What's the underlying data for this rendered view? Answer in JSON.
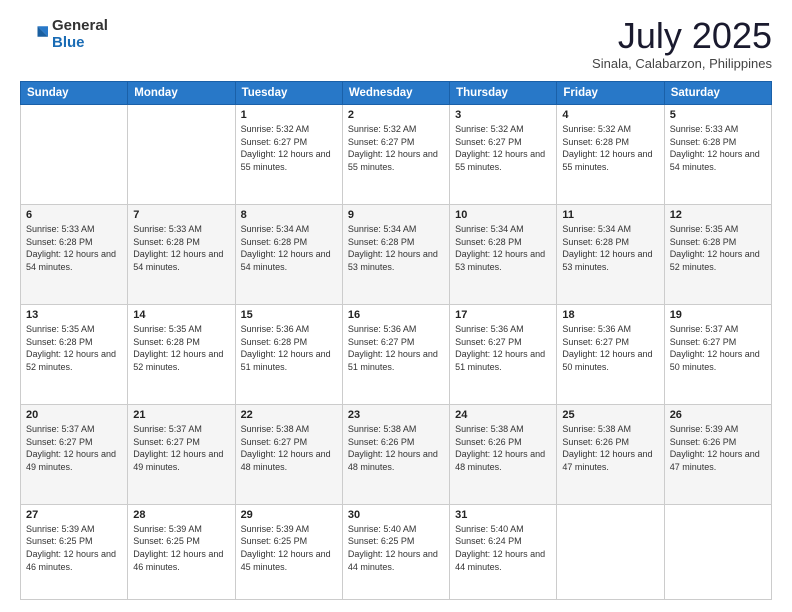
{
  "header": {
    "logo_general": "General",
    "logo_blue": "Blue",
    "month_year": "July 2025",
    "location": "Sinala, Calabarzon, Philippines"
  },
  "weekdays": [
    "Sunday",
    "Monday",
    "Tuesday",
    "Wednesday",
    "Thursday",
    "Friday",
    "Saturday"
  ],
  "weeks": [
    [
      {
        "day": "",
        "sunrise": "",
        "sunset": "",
        "daylight": ""
      },
      {
        "day": "",
        "sunrise": "",
        "sunset": "",
        "daylight": ""
      },
      {
        "day": "1",
        "sunrise": "Sunrise: 5:32 AM",
        "sunset": "Sunset: 6:27 PM",
        "daylight": "Daylight: 12 hours and 55 minutes."
      },
      {
        "day": "2",
        "sunrise": "Sunrise: 5:32 AM",
        "sunset": "Sunset: 6:27 PM",
        "daylight": "Daylight: 12 hours and 55 minutes."
      },
      {
        "day": "3",
        "sunrise": "Sunrise: 5:32 AM",
        "sunset": "Sunset: 6:27 PM",
        "daylight": "Daylight: 12 hours and 55 minutes."
      },
      {
        "day": "4",
        "sunrise": "Sunrise: 5:32 AM",
        "sunset": "Sunset: 6:28 PM",
        "daylight": "Daylight: 12 hours and 55 minutes."
      },
      {
        "day": "5",
        "sunrise": "Sunrise: 5:33 AM",
        "sunset": "Sunset: 6:28 PM",
        "daylight": "Daylight: 12 hours and 54 minutes."
      }
    ],
    [
      {
        "day": "6",
        "sunrise": "Sunrise: 5:33 AM",
        "sunset": "Sunset: 6:28 PM",
        "daylight": "Daylight: 12 hours and 54 minutes."
      },
      {
        "day": "7",
        "sunrise": "Sunrise: 5:33 AM",
        "sunset": "Sunset: 6:28 PM",
        "daylight": "Daylight: 12 hours and 54 minutes."
      },
      {
        "day": "8",
        "sunrise": "Sunrise: 5:34 AM",
        "sunset": "Sunset: 6:28 PM",
        "daylight": "Daylight: 12 hours and 54 minutes."
      },
      {
        "day": "9",
        "sunrise": "Sunrise: 5:34 AM",
        "sunset": "Sunset: 6:28 PM",
        "daylight": "Daylight: 12 hours and 53 minutes."
      },
      {
        "day": "10",
        "sunrise": "Sunrise: 5:34 AM",
        "sunset": "Sunset: 6:28 PM",
        "daylight": "Daylight: 12 hours and 53 minutes."
      },
      {
        "day": "11",
        "sunrise": "Sunrise: 5:34 AM",
        "sunset": "Sunset: 6:28 PM",
        "daylight": "Daylight: 12 hours and 53 minutes."
      },
      {
        "day": "12",
        "sunrise": "Sunrise: 5:35 AM",
        "sunset": "Sunset: 6:28 PM",
        "daylight": "Daylight: 12 hours and 52 minutes."
      }
    ],
    [
      {
        "day": "13",
        "sunrise": "Sunrise: 5:35 AM",
        "sunset": "Sunset: 6:28 PM",
        "daylight": "Daylight: 12 hours and 52 minutes."
      },
      {
        "day": "14",
        "sunrise": "Sunrise: 5:35 AM",
        "sunset": "Sunset: 6:28 PM",
        "daylight": "Daylight: 12 hours and 52 minutes."
      },
      {
        "day": "15",
        "sunrise": "Sunrise: 5:36 AM",
        "sunset": "Sunset: 6:28 PM",
        "daylight": "Daylight: 12 hours and 51 minutes."
      },
      {
        "day": "16",
        "sunrise": "Sunrise: 5:36 AM",
        "sunset": "Sunset: 6:27 PM",
        "daylight": "Daylight: 12 hours and 51 minutes."
      },
      {
        "day": "17",
        "sunrise": "Sunrise: 5:36 AM",
        "sunset": "Sunset: 6:27 PM",
        "daylight": "Daylight: 12 hours and 51 minutes."
      },
      {
        "day": "18",
        "sunrise": "Sunrise: 5:36 AM",
        "sunset": "Sunset: 6:27 PM",
        "daylight": "Daylight: 12 hours and 50 minutes."
      },
      {
        "day": "19",
        "sunrise": "Sunrise: 5:37 AM",
        "sunset": "Sunset: 6:27 PM",
        "daylight": "Daylight: 12 hours and 50 minutes."
      }
    ],
    [
      {
        "day": "20",
        "sunrise": "Sunrise: 5:37 AM",
        "sunset": "Sunset: 6:27 PM",
        "daylight": "Daylight: 12 hours and 49 minutes."
      },
      {
        "day": "21",
        "sunrise": "Sunrise: 5:37 AM",
        "sunset": "Sunset: 6:27 PM",
        "daylight": "Daylight: 12 hours and 49 minutes."
      },
      {
        "day": "22",
        "sunrise": "Sunrise: 5:38 AM",
        "sunset": "Sunset: 6:27 PM",
        "daylight": "Daylight: 12 hours and 48 minutes."
      },
      {
        "day": "23",
        "sunrise": "Sunrise: 5:38 AM",
        "sunset": "Sunset: 6:26 PM",
        "daylight": "Daylight: 12 hours and 48 minutes."
      },
      {
        "day": "24",
        "sunrise": "Sunrise: 5:38 AM",
        "sunset": "Sunset: 6:26 PM",
        "daylight": "Daylight: 12 hours and 48 minutes."
      },
      {
        "day": "25",
        "sunrise": "Sunrise: 5:38 AM",
        "sunset": "Sunset: 6:26 PM",
        "daylight": "Daylight: 12 hours and 47 minutes."
      },
      {
        "day": "26",
        "sunrise": "Sunrise: 5:39 AM",
        "sunset": "Sunset: 6:26 PM",
        "daylight": "Daylight: 12 hours and 47 minutes."
      }
    ],
    [
      {
        "day": "27",
        "sunrise": "Sunrise: 5:39 AM",
        "sunset": "Sunset: 6:25 PM",
        "daylight": "Daylight: 12 hours and 46 minutes."
      },
      {
        "day": "28",
        "sunrise": "Sunrise: 5:39 AM",
        "sunset": "Sunset: 6:25 PM",
        "daylight": "Daylight: 12 hours and 46 minutes."
      },
      {
        "day": "29",
        "sunrise": "Sunrise: 5:39 AM",
        "sunset": "Sunset: 6:25 PM",
        "daylight": "Daylight: 12 hours and 45 minutes."
      },
      {
        "day": "30",
        "sunrise": "Sunrise: 5:40 AM",
        "sunset": "Sunset: 6:25 PM",
        "daylight": "Daylight: 12 hours and 44 minutes."
      },
      {
        "day": "31",
        "sunrise": "Sunrise: 5:40 AM",
        "sunset": "Sunset: 6:24 PM",
        "daylight": "Daylight: 12 hours and 44 minutes."
      },
      {
        "day": "",
        "sunrise": "",
        "sunset": "",
        "daylight": ""
      },
      {
        "day": "",
        "sunrise": "",
        "sunset": "",
        "daylight": ""
      }
    ]
  ]
}
